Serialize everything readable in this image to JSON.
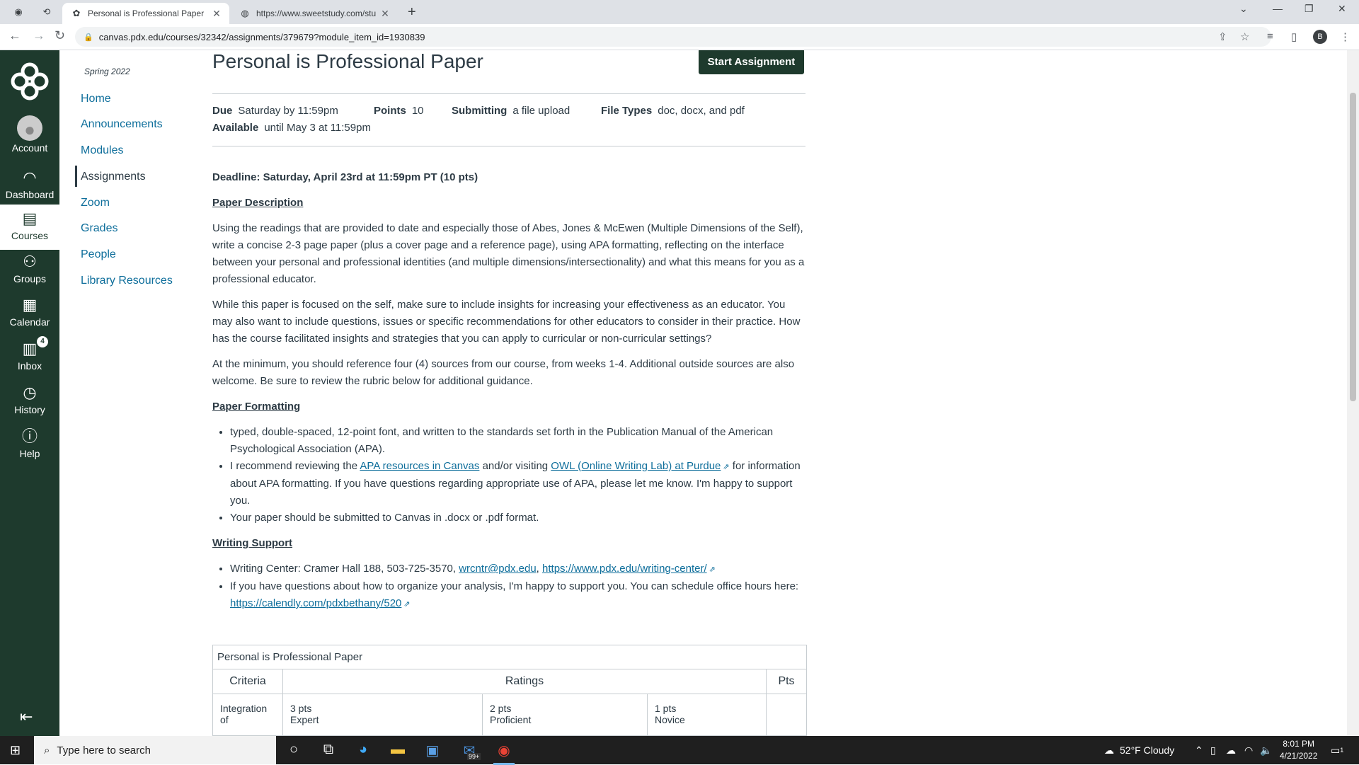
{
  "browser": {
    "tabs": [
      {
        "title": "Personal is Professional Paper",
        "active": true
      },
      {
        "title": "https://www.sweetstudy.com/stu",
        "active": false
      }
    ],
    "url": "canvas.pdx.edu/courses/32342/assignments/379679?module_item_id=1930839",
    "profile_initial": "B"
  },
  "global_nav": {
    "items": [
      {
        "label": "Account",
        "icon": "account-icon"
      },
      {
        "label": "Dashboard",
        "icon": "dashboard-icon"
      },
      {
        "label": "Courses",
        "icon": "courses-icon"
      },
      {
        "label": "Groups",
        "icon": "groups-icon"
      },
      {
        "label": "Calendar",
        "icon": "calendar-icon"
      },
      {
        "label": "Inbox",
        "icon": "inbox-icon",
        "badge": "4"
      },
      {
        "label": "History",
        "icon": "history-icon"
      },
      {
        "label": "Help",
        "icon": "help-icon"
      }
    ]
  },
  "course_nav": {
    "term": "Spring 2022",
    "items": [
      "Home",
      "Announcements",
      "Modules",
      "Assignments",
      "Zoom",
      "Grades",
      "People",
      "Library Resources"
    ],
    "active": "Assignments"
  },
  "assignment": {
    "title": "Personal is Professional Paper",
    "start_button": "Start Assignment",
    "due_label": "Due",
    "due_value": "Saturday by 11:59pm",
    "points_label": "Points",
    "points_value": "10",
    "submitting_label": "Submitting",
    "submitting_value": "a file upload",
    "filetypes_label": "File Types",
    "filetypes_value": "doc, docx, and pdf",
    "available_label": "Available",
    "available_value": "until May 3 at 11:59pm"
  },
  "content": {
    "deadline": "Deadline: Saturday, April 23rd at 11:59pm PT (10 pts)",
    "desc_heading": "Paper Description",
    "desc_p1": "Using the readings that are provided to date and especially those of Abes, Jones & McEwen (Multiple Dimensions of the Self), write a concise 2-3 page paper (plus a cover page and a reference page), using APA formatting, reflecting on the interface between your personal and professional identities (and multiple dimensions/intersectionality) and what this means for you as a professional educator.",
    "desc_p2": "While this paper is focused on the self, make sure to include insights for increasing your effectiveness as an educator. You may also want to include questions, issues or specific recommendations for other educators to consider in their practice. How has the course facilitated insights and strategies that you can apply to curricular or non-curricular settings?",
    "desc_p3": "At the minimum, you should reference four (4) sources from our course, from weeks 1-4. Additional outside sources are also welcome. Be sure to review the rubric below for additional guidance.",
    "fmt_heading": "Paper Formatting",
    "fmt_b1": "typed, double-spaced, 12-point font, and written to the standards set forth in the Publication Manual of the American Psychological Association (APA).",
    "fmt_b2_pre": "I recommend reviewing the ",
    "fmt_b2_link1": "APA resources in Canvas",
    "fmt_b2_mid": " and/or visiting ",
    "fmt_b2_link2": "OWL (Online Writing Lab) at Purdue",
    "fmt_b2_post": " for information about APA formatting. If you have questions regarding appropriate use of APA, please let me know. I'm happy to support you.",
    "fmt_b3": "Your paper should be submitted to Canvas in .docx or .pdf format.",
    "ws_heading": "Writing Support",
    "ws_b1_pre": "Writing Center: Cramer Hall 188, 503-725-3570, ",
    "ws_b1_email": "wrcntr@pdx.edu",
    "ws_b1_sep": ", ",
    "ws_b1_url": "https://www.pdx.edu/writing-center/",
    "ws_b2_pre": "If you have questions about how to organize your analysis, I'm happy to support you. You can schedule office hours here: ",
    "ws_b2_url": "https://calendly.com/pdxbethany/520"
  },
  "rubric": {
    "title": "Personal is Professional Paper",
    "col_criteria": "Criteria",
    "col_ratings": "Ratings",
    "col_pts": "Pts",
    "row1": {
      "criterion": "Integration of",
      "r1_pts": "3 pts",
      "r1_name": "Expert",
      "r2_pts": "2 pts",
      "r2_name": "Proficient",
      "r3_pts": "1 pts",
      "r3_name": "Novice"
    }
  },
  "taskbar": {
    "search_placeholder": "Type here to search",
    "weather": "52°F  Cloudy",
    "time": "8:01 PM",
    "date": "4/21/2022",
    "mail_badge": "99+",
    "notif_count": "1"
  }
}
